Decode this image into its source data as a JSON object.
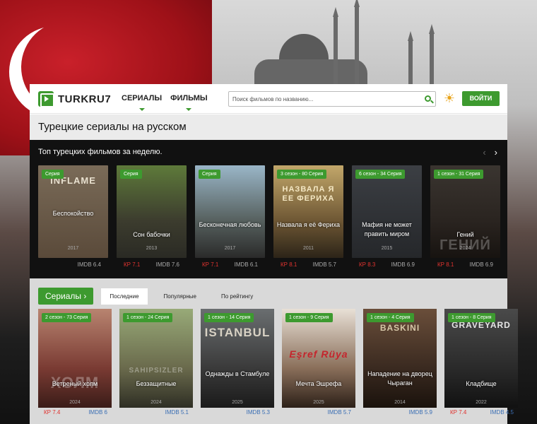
{
  "site": {
    "logo": "TURKRU7"
  },
  "nav": {
    "items": [
      "СЕРИАЛЫ",
      "ФИЛЬМЫ"
    ]
  },
  "search": {
    "placeholder": "Поиск фильмов по названию..."
  },
  "auth": {
    "login_label": "ВОЙТИ"
  },
  "page": {
    "title": "Турецкие сериалы на русском"
  },
  "top_week": {
    "title": "Топ турецких фильмов за неделю.",
    "prev": "‹",
    "next": "›",
    "items": [
      {
        "badge": "Серия",
        "title": "Беспокойство",
        "year": "2017",
        "poster_art": "INFLAME",
        "kp": "",
        "imdb": "IMDB 6.4"
      },
      {
        "badge": "Серия",
        "title": "Сон бабочки",
        "year": "2013",
        "poster_art": "",
        "kp": "КР 7.1",
        "imdb": "IMDB 7.6"
      },
      {
        "badge": "Серия",
        "title": "Бесконечная любовь",
        "year": "2017",
        "poster_art": "",
        "kp": "КР 7.1",
        "imdb": "IMDB 6.1"
      },
      {
        "badge": "3 сезон - 80 Серия",
        "title": "Назвала я её Фериха",
        "year": "2011",
        "poster_art": "НАЗВАЛА Я ЕЕ ФЕРИХА",
        "kp": "КР 8.1",
        "imdb": "IMDB 5.7"
      },
      {
        "badge": "6 сезон - 34 Серия",
        "title": "Мафия не может править миром",
        "year": "2015",
        "poster_art": "",
        "kp": "КР 8.3",
        "imdb": "IMDB 6.9"
      },
      {
        "badge": "1 сезон - 31 Серия",
        "title": "Гений",
        "year": "2024",
        "poster_art": "ГЕНИЙ",
        "kp": "КР 8.1",
        "imdb": "IMDB 6.9"
      }
    ]
  },
  "series": {
    "button_label": "Сериалы",
    "tabs": [
      "Последние",
      "Популярные",
      "По рейтингу"
    ],
    "items": [
      {
        "badge": "2 сезон - 73 Серия",
        "title": "Ветреный холм",
        "year": "2024",
        "poster_art": "ХОЛМ",
        "kp": "КР 7.4",
        "imdb": "IMDB 6"
      },
      {
        "badge": "1 сезон - 24 Серия",
        "title": "Беззащитные",
        "year": "2024",
        "poster_art": "SAHIPSIZLER",
        "kp": "",
        "imdb": "IMDB 5.1"
      },
      {
        "badge": "1 сезон - 14 Серия",
        "title": "Однажды в Стамбуле",
        "year": "2025",
        "poster_art": "ISTANBUL",
        "kp": "",
        "imdb": "IMDB 5.3"
      },
      {
        "badge": "1 сезон - 9 Серия",
        "title": "Мечта Эшрефа",
        "year": "2025",
        "poster_art": "Eşref Rüya",
        "kp": "",
        "imdb": "IMDB 5.7"
      },
      {
        "badge": "1 сезон - 4 Серия",
        "title": "Нападение на дворец Чыраган",
        "year": "2014",
        "poster_art": "BASKINI",
        "kp": "",
        "imdb": "IMDB 5.9"
      },
      {
        "badge": "1 сезон - 8 Серия",
        "title": "Кладбище",
        "year": "2022",
        "poster_art": "GRAVEYARD",
        "kp": "КР 7.4",
        "imdb": "IMDB 4.5"
      }
    ]
  },
  "colors": {
    "accent": "#3d9a2f",
    "kp": "#e0332f",
    "imdb_light": "#3b6fb4"
  }
}
